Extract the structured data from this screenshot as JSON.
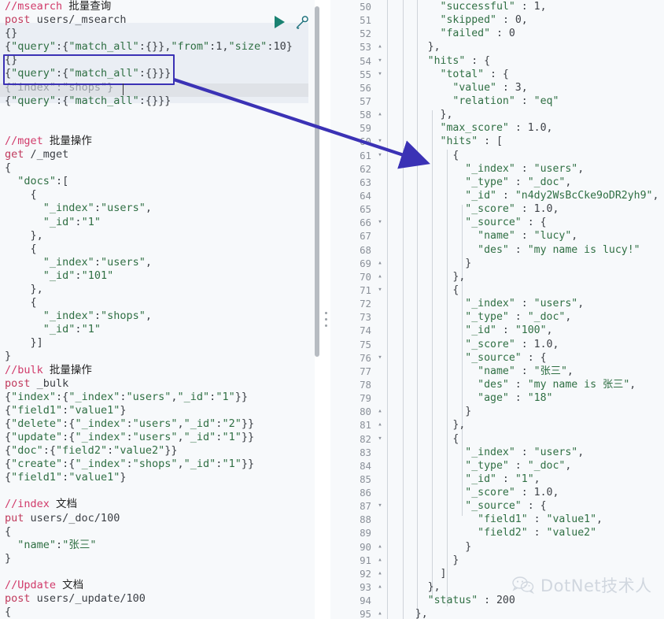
{
  "editor": {
    "toolbar": {
      "run_label": "play-icon",
      "wrench_label": "wrench-icon"
    },
    "lines": [
      {
        "t": "//msearch 批量查询",
        "k": "comment"
      },
      {
        "t": "post users/_msearch",
        "k": "method"
      },
      {
        "t": "{}",
        "k": "json"
      },
      {
        "t": "{\"query\":{\"match_all\":{}},\"from\":1,\"size\":10}",
        "k": "json"
      },
      {
        "t": "{}",
        "k": "json"
      },
      {
        "t": "{\"query\":{\"match_all\":{}}}",
        "k": "json"
      },
      {
        "t": "{\"index\":\"shops\"}",
        "k": "json-dim"
      },
      {
        "t": "{\"query\":{\"match_all\":{}}}",
        "k": "json"
      },
      {
        "t": "",
        "k": "blank"
      },
      {
        "t": "",
        "k": "blank"
      },
      {
        "t": "//mget 批量操作",
        "k": "comment"
      },
      {
        "t": "get /_mget",
        "k": "method"
      },
      {
        "t": "{",
        "k": "json"
      },
      {
        "t": "  \"docs\":[",
        "k": "json"
      },
      {
        "t": "    {",
        "k": "json"
      },
      {
        "t": "      \"_index\":\"users\",",
        "k": "json"
      },
      {
        "t": "      \"_id\":\"1\"",
        "k": "json"
      },
      {
        "t": "    },",
        "k": "json"
      },
      {
        "t": "    {",
        "k": "json"
      },
      {
        "t": "      \"_index\":\"users\",",
        "k": "json"
      },
      {
        "t": "      \"_id\":\"101\"",
        "k": "json"
      },
      {
        "t": "    },",
        "k": "json"
      },
      {
        "t": "    {",
        "k": "json"
      },
      {
        "t": "      \"_index\":\"shops\",",
        "k": "json"
      },
      {
        "t": "      \"_id\":\"1\"",
        "k": "json"
      },
      {
        "t": "    }]",
        "k": "json"
      },
      {
        "t": "}",
        "k": "json"
      },
      {
        "t": "//bulk 批量操作",
        "k": "comment"
      },
      {
        "t": "post _bulk",
        "k": "method"
      },
      {
        "t": "{\"index\":{\"_index\":\"users\",\"_id\":\"1\"}}",
        "k": "json"
      },
      {
        "t": "{\"field1\":\"value1\"}",
        "k": "json"
      },
      {
        "t": "{\"delete\":{\"_index\":\"users\",\"_id\":\"2\"}}",
        "k": "json"
      },
      {
        "t": "{\"update\":{\"_index\":\"users\",\"_id\":\"1\"}}",
        "k": "json"
      },
      {
        "t": "{\"doc\":{\"field2\":\"value2\"}}",
        "k": "json"
      },
      {
        "t": "{\"create\":{\"_index\":\"shops\",\"_id\":\"1\"}}",
        "k": "json"
      },
      {
        "t": "{\"field1\":\"value1\"}",
        "k": "json"
      },
      {
        "t": "",
        "k": "blank"
      },
      {
        "t": "//index 文档",
        "k": "comment"
      },
      {
        "t": "put users/_doc/100",
        "k": "method"
      },
      {
        "t": "{",
        "k": "json"
      },
      {
        "t": "  \"name\":\"张三\"",
        "k": "json"
      },
      {
        "t": "}",
        "k": "json"
      },
      {
        "t": "",
        "k": "blank"
      },
      {
        "t": "//Update 文档",
        "k": "comment"
      },
      {
        "t": "post users/_update/100",
        "k": "method"
      },
      {
        "t": "{",
        "k": "json"
      }
    ]
  },
  "response": {
    "rows": [
      {
        "n": "50",
        "fold": "",
        "t": "        \"successful\" : 1,"
      },
      {
        "n": "51",
        "fold": "",
        "t": "        \"skipped\" : 0,"
      },
      {
        "n": "52",
        "fold": "",
        "t": "        \"failed\" : 0"
      },
      {
        "n": "53",
        "fold": "▴",
        "t": "      },"
      },
      {
        "n": "54",
        "fold": "▾",
        "t": "      \"hits\" : {"
      },
      {
        "n": "55",
        "fold": "▾",
        "t": "        \"total\" : {"
      },
      {
        "n": "56",
        "fold": "",
        "t": "          \"value\" : 3,"
      },
      {
        "n": "57",
        "fold": "",
        "t": "          \"relation\" : \"eq\""
      },
      {
        "n": "58",
        "fold": "▴",
        "t": "        },"
      },
      {
        "n": "59",
        "fold": "",
        "t": "        \"max_score\" : 1.0,"
      },
      {
        "n": "60",
        "fold": "▾",
        "t": "        \"hits\" : ["
      },
      {
        "n": "61",
        "fold": "▾",
        "t": "          {"
      },
      {
        "n": "62",
        "fold": "",
        "t": "            \"_index\" : \"users\","
      },
      {
        "n": "63",
        "fold": "",
        "t": "            \"_type\" : \"_doc\","
      },
      {
        "n": "64",
        "fold": "",
        "t": "            \"_id\" : \"n4dy2WsBcCke9oDR2yh9\","
      },
      {
        "n": "65",
        "fold": "",
        "t": "            \"_score\" : 1.0,"
      },
      {
        "n": "66",
        "fold": "▾",
        "t": "            \"_source\" : {"
      },
      {
        "n": "67",
        "fold": "",
        "t": "              \"name\" : \"lucy\","
      },
      {
        "n": "68",
        "fold": "",
        "t": "              \"des\" : \"my name is lucy!\""
      },
      {
        "n": "69",
        "fold": "▴",
        "t": "            }"
      },
      {
        "n": "70",
        "fold": "▴",
        "t": "          },"
      },
      {
        "n": "71",
        "fold": "▾",
        "t": "          {"
      },
      {
        "n": "72",
        "fold": "",
        "t": "            \"_index\" : \"users\","
      },
      {
        "n": "73",
        "fold": "",
        "t": "            \"_type\" : \"_doc\","
      },
      {
        "n": "74",
        "fold": "",
        "t": "            \"_id\" : \"100\","
      },
      {
        "n": "75",
        "fold": "",
        "t": "            \"_score\" : 1.0,"
      },
      {
        "n": "76",
        "fold": "▾",
        "t": "            \"_source\" : {"
      },
      {
        "n": "77",
        "fold": "",
        "t": "              \"name\" : \"张三\","
      },
      {
        "n": "78",
        "fold": "",
        "t": "              \"des\" : \"my name is 张三\","
      },
      {
        "n": "79",
        "fold": "",
        "t": "              \"age\" : \"18\""
      },
      {
        "n": "80",
        "fold": "▴",
        "t": "            }"
      },
      {
        "n": "81",
        "fold": "▴",
        "t": "          },"
      },
      {
        "n": "82",
        "fold": "▾",
        "t": "          {"
      },
      {
        "n": "83",
        "fold": "",
        "t": "            \"_index\" : \"users\","
      },
      {
        "n": "84",
        "fold": "",
        "t": "            \"_type\" : \"_doc\","
      },
      {
        "n": "85",
        "fold": "",
        "t": "            \"_id\" : \"1\","
      },
      {
        "n": "86",
        "fold": "",
        "t": "            \"_score\" : 1.0,"
      },
      {
        "n": "87",
        "fold": "▾",
        "t": "            \"_source\" : {"
      },
      {
        "n": "88",
        "fold": "",
        "t": "              \"field1\" : \"value1\","
      },
      {
        "n": "89",
        "fold": "",
        "t": "              \"field2\" : \"value2\""
      },
      {
        "n": "90",
        "fold": "▴",
        "t": "            }"
      },
      {
        "n": "91",
        "fold": "▴",
        "t": "          }"
      },
      {
        "n": "92",
        "fold": "▴",
        "t": "        ]"
      },
      {
        "n": "93",
        "fold": "▴",
        "t": "      },"
      },
      {
        "n": "94",
        "fold": "",
        "t": "      \"status\" : 200"
      },
      {
        "n": "95",
        "fold": "▴",
        "t": "    },"
      }
    ]
  },
  "annotation": {
    "box_label": "highlight-box",
    "arrow_label": "annotation-arrow",
    "color": "#3b32b5"
  },
  "watermark": {
    "text": "DotNet技术人"
  },
  "colors": {
    "accent": "#3b32b5",
    "run": "#1a8272",
    "comment": "#d13a6a",
    "string": "#2f6f43",
    "editor_bg": "#f7f9fb",
    "block_bg": "#eaeef4"
  }
}
